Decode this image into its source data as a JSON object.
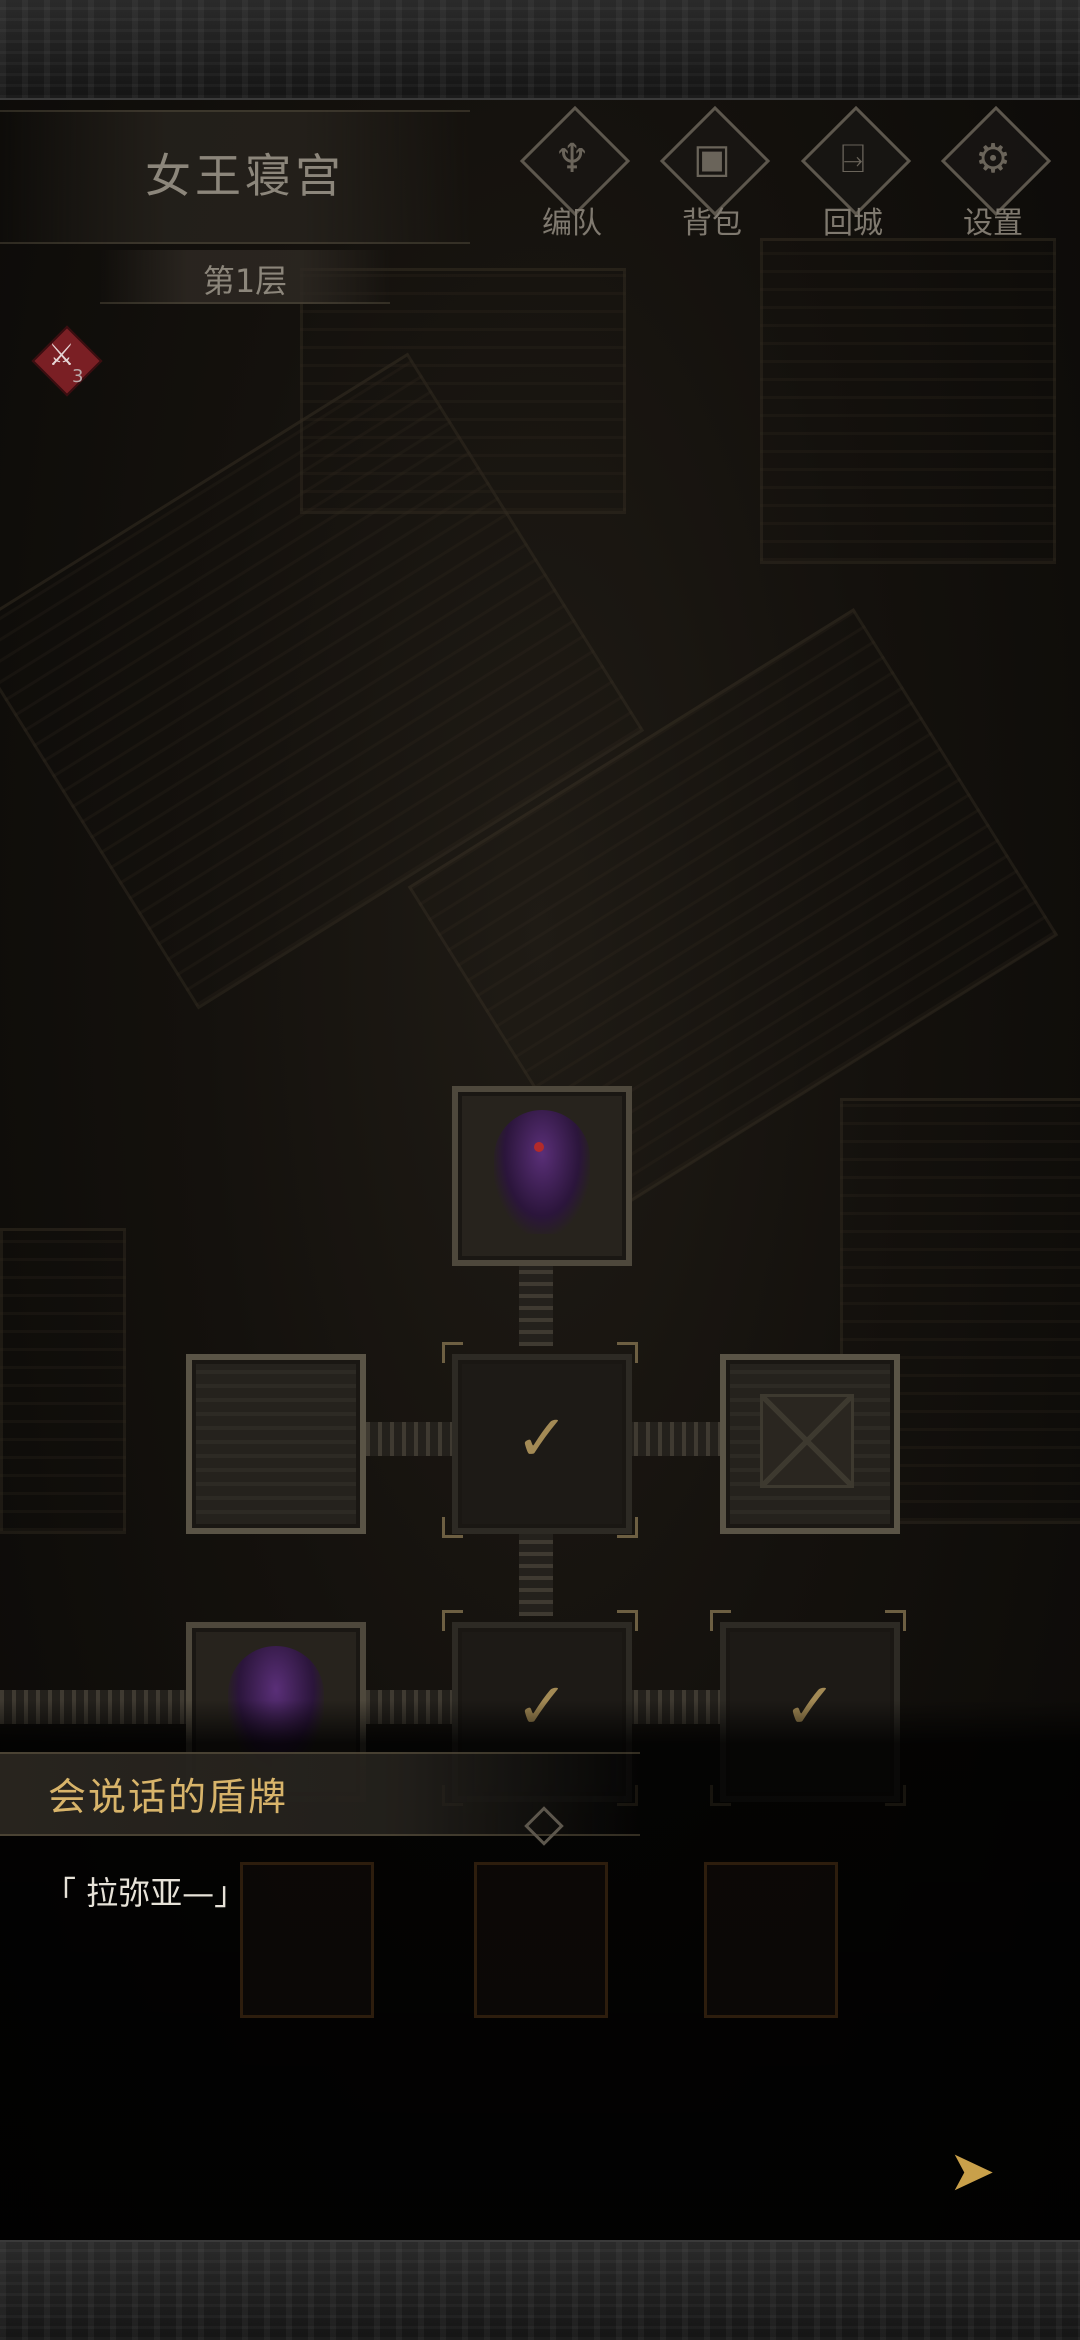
{
  "header": {
    "dungeon_name": "女王寝宫",
    "floor": "第1层"
  },
  "toolbar": {
    "team_label": "编队",
    "bag_label": "背包",
    "return_label": "回城",
    "settings_label": "设置"
  },
  "status": {
    "badge_count": "3"
  },
  "dialogue": {
    "speaker": "会说话的盾牌",
    "text": "「 拉弥亚—」"
  },
  "icons": {
    "team": "horned-helmet-icon",
    "bag": "backpack-icon",
    "return": "door-exit-icon",
    "settings": "gear-icon",
    "next": "next-arrow-icon",
    "room_cleared": "checkmark-icon"
  },
  "colors": {
    "accent_gold": "#d8b46a",
    "check_gold": "#a38a55",
    "status_red": "#7a1f24"
  }
}
